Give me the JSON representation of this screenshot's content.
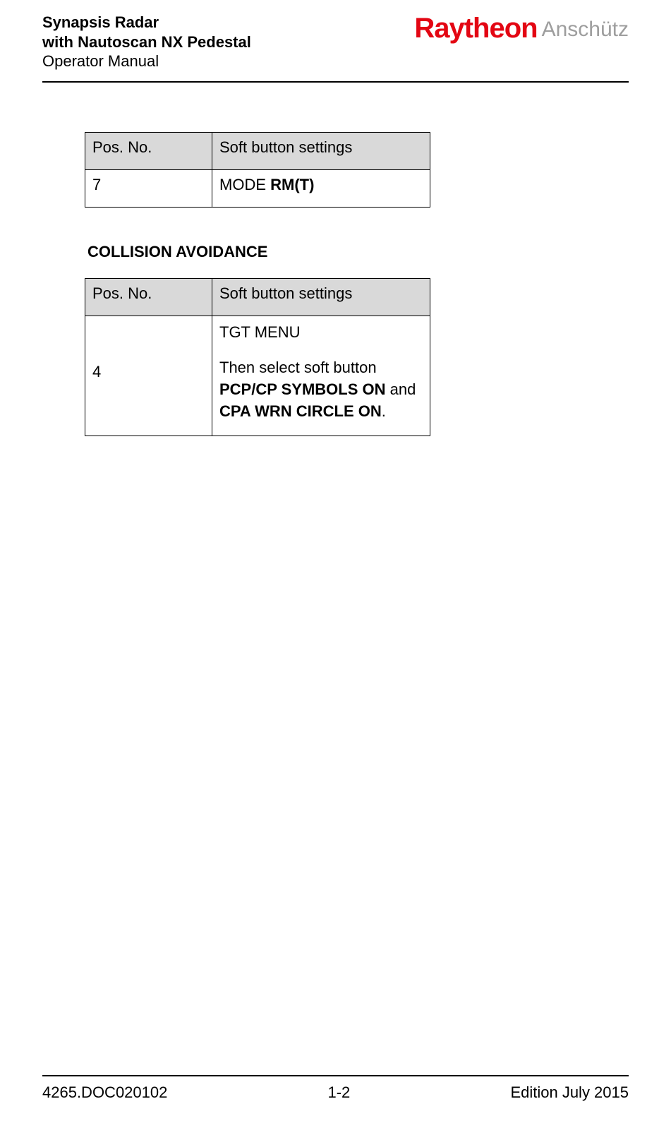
{
  "header": {
    "line1": "Synapsis Radar",
    "line2": "with Nautoscan NX Pedestal",
    "line3": "Operator Manual",
    "logo_primary": "Raytheon",
    "logo_secondary": "Anschütz"
  },
  "table1": {
    "col1_header": "Pos. No.",
    "col2_header": "Soft button settings",
    "row1_pos": "7",
    "row1_prefix": "MODE ",
    "row1_bold": "RM(T)"
  },
  "section_title": "COLLISION AVOIDANCE",
  "table2": {
    "col1_header": "Pos. No.",
    "col2_header": "Soft button settings",
    "row1_pos": "4",
    "row1_line1": "TGT MENU",
    "row1_line2": "Then select soft button ",
    "row1_bold1": "PCP/CP SYMBOLS ON",
    "row1_mid": " and ",
    "row1_bold2": "CPA WRN CIRCLE ON",
    "row1_end": "."
  },
  "footer": {
    "left": "4265.DOC020102",
    "center": "1-2",
    "right": "Edition July 2015"
  }
}
